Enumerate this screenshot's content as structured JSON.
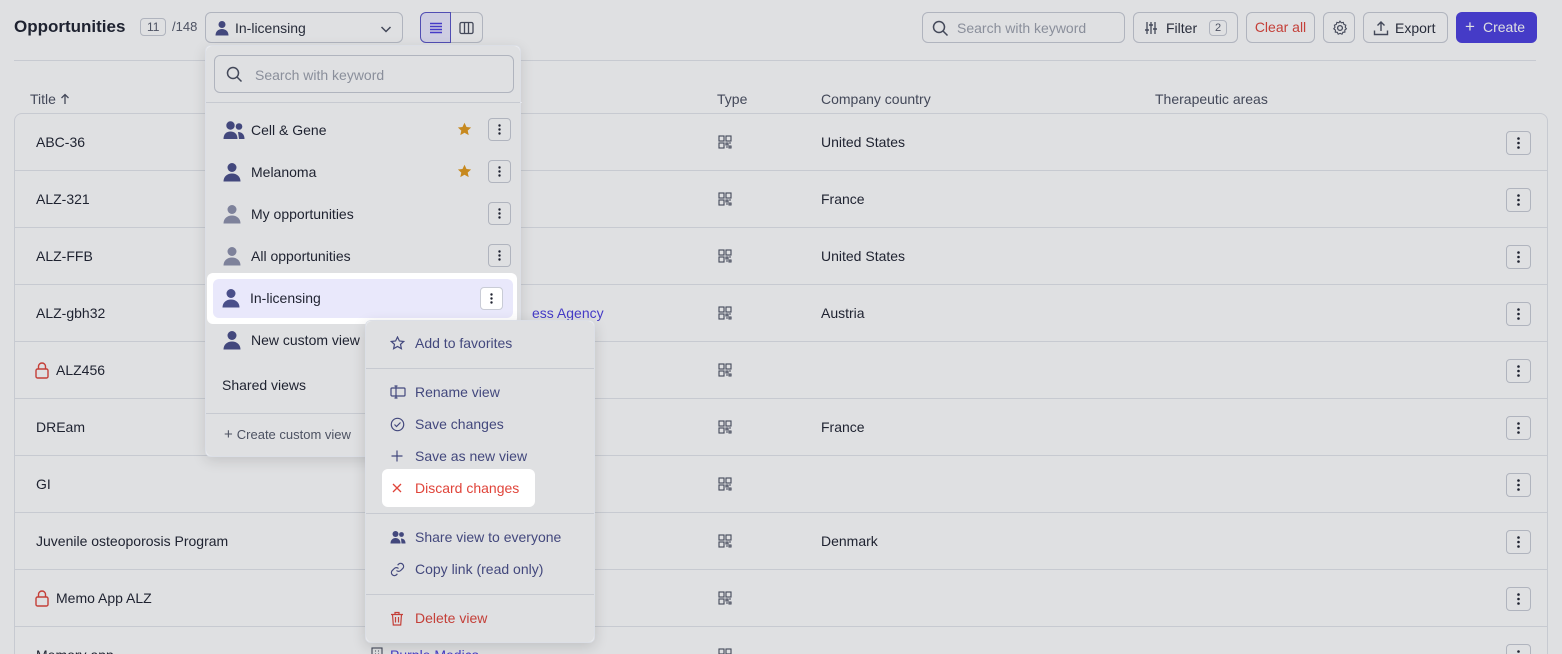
{
  "header": {
    "title": "Opportunities",
    "count": "11",
    "total": "/148",
    "current_view": "In-licensing",
    "search_placeholder": "Search with keyword",
    "filter_label": "Filter",
    "filter_count": "2",
    "clear_all": "Clear all",
    "export_label": "Export",
    "create_label": "Create"
  },
  "table": {
    "columns": [
      "Title",
      "Type",
      "Company country",
      "Therapeutic areas"
    ],
    "rows": [
      {
        "title": "ABC-36",
        "locked": false,
        "company": "",
        "country": "United States"
      },
      {
        "title": "ALZ-321",
        "locked": false,
        "company": "",
        "country": "France"
      },
      {
        "title": "ALZ-FFB",
        "locked": false,
        "company": "",
        "country": "United States"
      },
      {
        "title": "ALZ-gbh32",
        "locked": false,
        "company": "ess Agency",
        "country": "Austria"
      },
      {
        "title": "ALZ456",
        "locked": true,
        "company": "",
        "country": ""
      },
      {
        "title": "DREam",
        "locked": false,
        "company": "",
        "country": "France"
      },
      {
        "title": "GI",
        "locked": false,
        "company": "",
        "country": ""
      },
      {
        "title": "Juvenile osteoporosis Program",
        "locked": false,
        "company": "",
        "country": "Denmark"
      },
      {
        "title": "Memo App ALZ",
        "locked": true,
        "company": "",
        "country": ""
      },
      {
        "title": "Memory app",
        "locked": false,
        "company": "Purple Medics",
        "country": ""
      }
    ]
  },
  "views_panel": {
    "search_placeholder": "Search with keyword",
    "items": [
      {
        "label": "Cell & Gene",
        "icon": "group-icon",
        "starred": true
      },
      {
        "label": "Melanoma",
        "icon": "user-icon",
        "starred": true
      },
      {
        "label": "My opportunities",
        "icon": "user-icon",
        "starred": false
      },
      {
        "label": "All opportunities",
        "icon": "user-icon",
        "starred": false
      },
      {
        "label": "In-licensing",
        "icon": "user-icon",
        "starred": false,
        "selected": true
      },
      {
        "label": "New custom view",
        "icon": "user-icon",
        "starred": false
      }
    ],
    "shared_label": "Shared views",
    "create_label": "Create custom view"
  },
  "context_menu": {
    "add_favorites": "Add to favorites",
    "rename": "Rename view",
    "save_changes": "Save changes",
    "save_as_new": "Save as new view",
    "discard": "Discard changes",
    "share": "Share view to everyone",
    "copy_link": "Copy link (read only)",
    "delete": "Delete view"
  },
  "colors": {
    "accent": "#4c3fe0",
    "danger": "#e0443a",
    "star": "#e39a1c",
    "selected_bg": "#e9e8fb"
  }
}
